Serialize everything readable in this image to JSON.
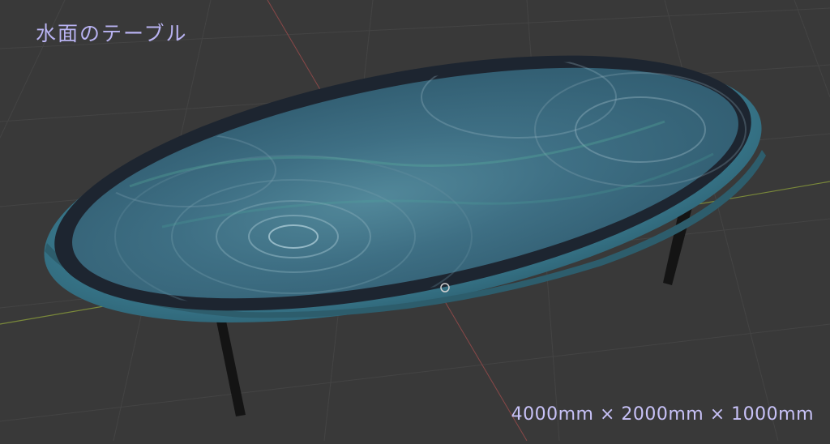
{
  "scene": {
    "title": "水面のテーブル",
    "dimensions": "4000mm × 2000mm × 1000mm"
  },
  "colors": {
    "background": "#393939",
    "grid": "#444444",
    "table_rim": "#3f7f95",
    "table_inner_ring": "#1d2530",
    "table_surface": "#3c6f84",
    "legs": "#141414",
    "text": "#b9b3f2"
  }
}
